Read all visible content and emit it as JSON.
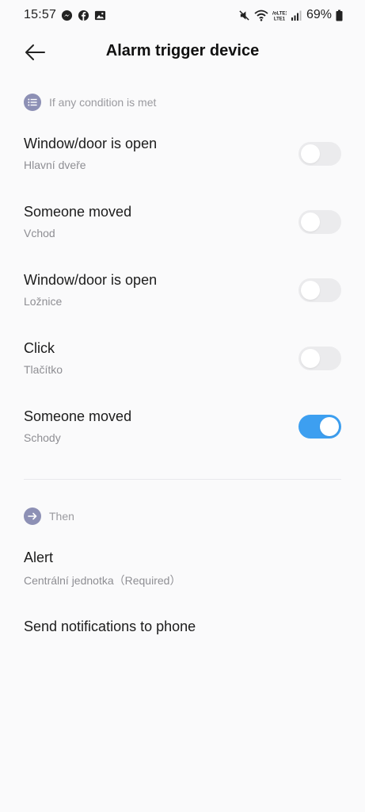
{
  "status_bar": {
    "time": "15:57",
    "battery": "69%",
    "left_icons": [
      "messenger-icon",
      "facebook-icon",
      "gallery-icon"
    ],
    "right_icons": [
      "mute-icon",
      "wifi-icon",
      "volte-icon",
      "signal-icon",
      "battery-icon"
    ],
    "volte_text": "VoLTE1"
  },
  "header": {
    "title": "Alarm trigger device",
    "back_icon": "arrow-left-icon"
  },
  "conditions": {
    "label": "If any condition is met",
    "items": [
      {
        "title": "Window/door is open",
        "subtitle": "Hlavní dveře",
        "enabled": false
      },
      {
        "title": "Someone moved",
        "subtitle": "Vchod",
        "enabled": false
      },
      {
        "title": "Window/door is open",
        "subtitle": "Ložnice",
        "enabled": false
      },
      {
        "title": "Click",
        "subtitle": "Tlačítko",
        "enabled": false
      },
      {
        "title": "Someone moved",
        "subtitle": "Schody",
        "enabled": true
      }
    ]
  },
  "actions": {
    "label": "Then",
    "items": [
      {
        "title": "Alert",
        "subtitle": "Centrální jednotka（Required）"
      },
      {
        "title": "Send notifications to phone",
        "subtitle": ""
      }
    ]
  },
  "colors": {
    "accent": "#3d9ff0",
    "toggle_off": "#ebebed",
    "section_badge": "#8d90b5",
    "background": "#fafafb"
  }
}
